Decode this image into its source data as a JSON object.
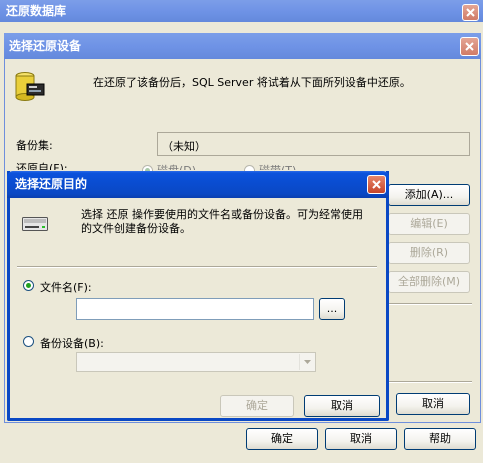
{
  "outer_dialog": {
    "title": "还原数据库",
    "buttons": {
      "ok": "确定",
      "cancel": "取消",
      "help": "帮助"
    }
  },
  "select_device_dialog": {
    "title": "选择还原设备",
    "info_text": "在还原了该备份后，SQL Server 将试着从下面所列设备中还原。",
    "backup_set_label": "备份集:",
    "backup_set_value": "（未知）",
    "restore_from_label": "还原自(F):",
    "radio_a_label": "磁盘(D)",
    "radio_b_label": "磁带(T)",
    "buttons": {
      "add": "添加(A)...",
      "edit": "编辑(E)",
      "delete": "删除(R)",
      "delete_all": "全部删除(M)",
      "cancel": "取消"
    }
  },
  "select_destination_dialog": {
    "title": "选择还原目的",
    "info_text": "选择 还原 操作要使用的文件名或备份设备。可为经常使用的文件创建备份设备。",
    "file_name_label": "文件名(F):",
    "file_name_value": "",
    "browse_label": "...",
    "backup_device_label": "备份设备(B):",
    "backup_device_value": "",
    "ok_label": "确定",
    "cancel_label": "取消"
  },
  "colors": {
    "titlebar": "#0a4ccf",
    "dialog_bg": "#ece9d8",
    "close_red": "#c6452a"
  }
}
